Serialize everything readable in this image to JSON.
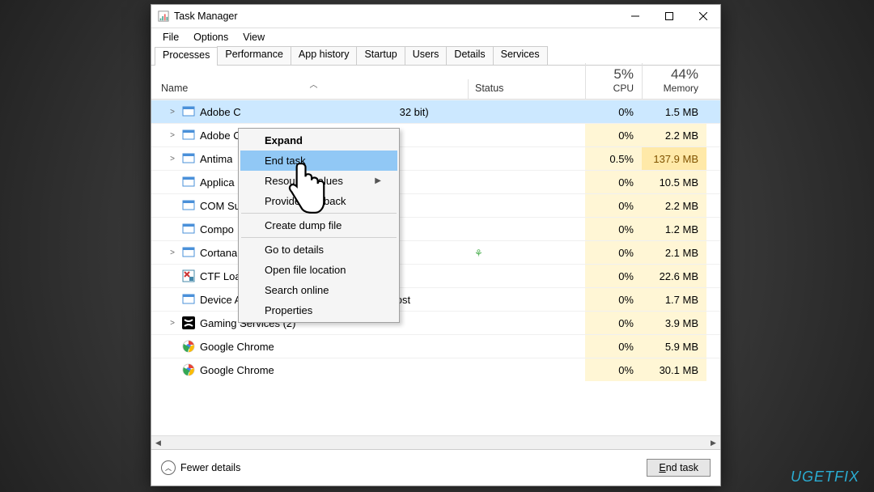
{
  "window": {
    "title": "Task Manager",
    "menuitems": [
      "File",
      "Options",
      "View"
    ],
    "win_minimize": "—",
    "win_maximize": "☐",
    "win_close": "✕"
  },
  "tabs": [
    "Processes",
    "Performance",
    "App history",
    "Startup",
    "Users",
    "Details",
    "Services"
  ],
  "columns": {
    "name": "Name",
    "status": "Status",
    "cpu_pct": "5%",
    "cpu_label": "CPU",
    "mem_pct": "44%",
    "mem_label": "Memory"
  },
  "processes": [
    {
      "name": "Adobe C",
      "suffix": "32 bit)",
      "cpu": "0%",
      "mem": "1.5 MB",
      "expandable": true,
      "selected": true,
      "icon": "app"
    },
    {
      "name": "Adobe C",
      "cpu": "0%",
      "mem": "2.2 MB",
      "expandable": true,
      "icon": "app"
    },
    {
      "name": "Antima",
      "cpu": "0.5%",
      "mem": "137.9 MB",
      "expandable": true,
      "icon": "app",
      "heavy": true
    },
    {
      "name": "Applica",
      "cpu": "0%",
      "mem": "10.5 MB",
      "icon": "app"
    },
    {
      "name": "COM Su",
      "cpu": "0%",
      "mem": "2.2 MB",
      "icon": "app"
    },
    {
      "name": "Compo",
      "cpu": "0%",
      "mem": "1.2 MB",
      "icon": "app"
    },
    {
      "name": "Cortana",
      "cpu": "0%",
      "mem": "2.1 MB",
      "expandable": true,
      "icon": "app",
      "leaf": true
    },
    {
      "name": "CTF Loa",
      "cpu": "0%",
      "mem": "22.6 MB",
      "icon": "ctf"
    },
    {
      "name": "Device Association Framework Provider Host",
      "cpu": "0%",
      "mem": "1.7 MB",
      "icon": "app"
    },
    {
      "name": "Gaming Services (2)",
      "cpu": "0%",
      "mem": "3.9 MB",
      "expandable": true,
      "icon": "xbox"
    },
    {
      "name": "Google Chrome",
      "cpu": "0%",
      "mem": "5.9 MB",
      "icon": "chrome"
    },
    {
      "name": "Google Chrome",
      "cpu": "0%",
      "mem": "30.1 MB",
      "icon": "chrome"
    }
  ],
  "context_menu": {
    "items": [
      {
        "label": "Expand",
        "bold": true
      },
      {
        "label": "End task",
        "hover": true
      },
      {
        "label": "Resource values",
        "submenu": true
      },
      {
        "label": "Provide feedback"
      },
      {
        "sep": true
      },
      {
        "label": "Create dump file"
      },
      {
        "sep": true
      },
      {
        "label": "Go to details"
      },
      {
        "label": "Open file location"
      },
      {
        "label": "Search online"
      },
      {
        "label": "Properties"
      }
    ]
  },
  "footer": {
    "fewer": "Fewer details",
    "endtask": "End task"
  },
  "watermark": "UGETFIX"
}
